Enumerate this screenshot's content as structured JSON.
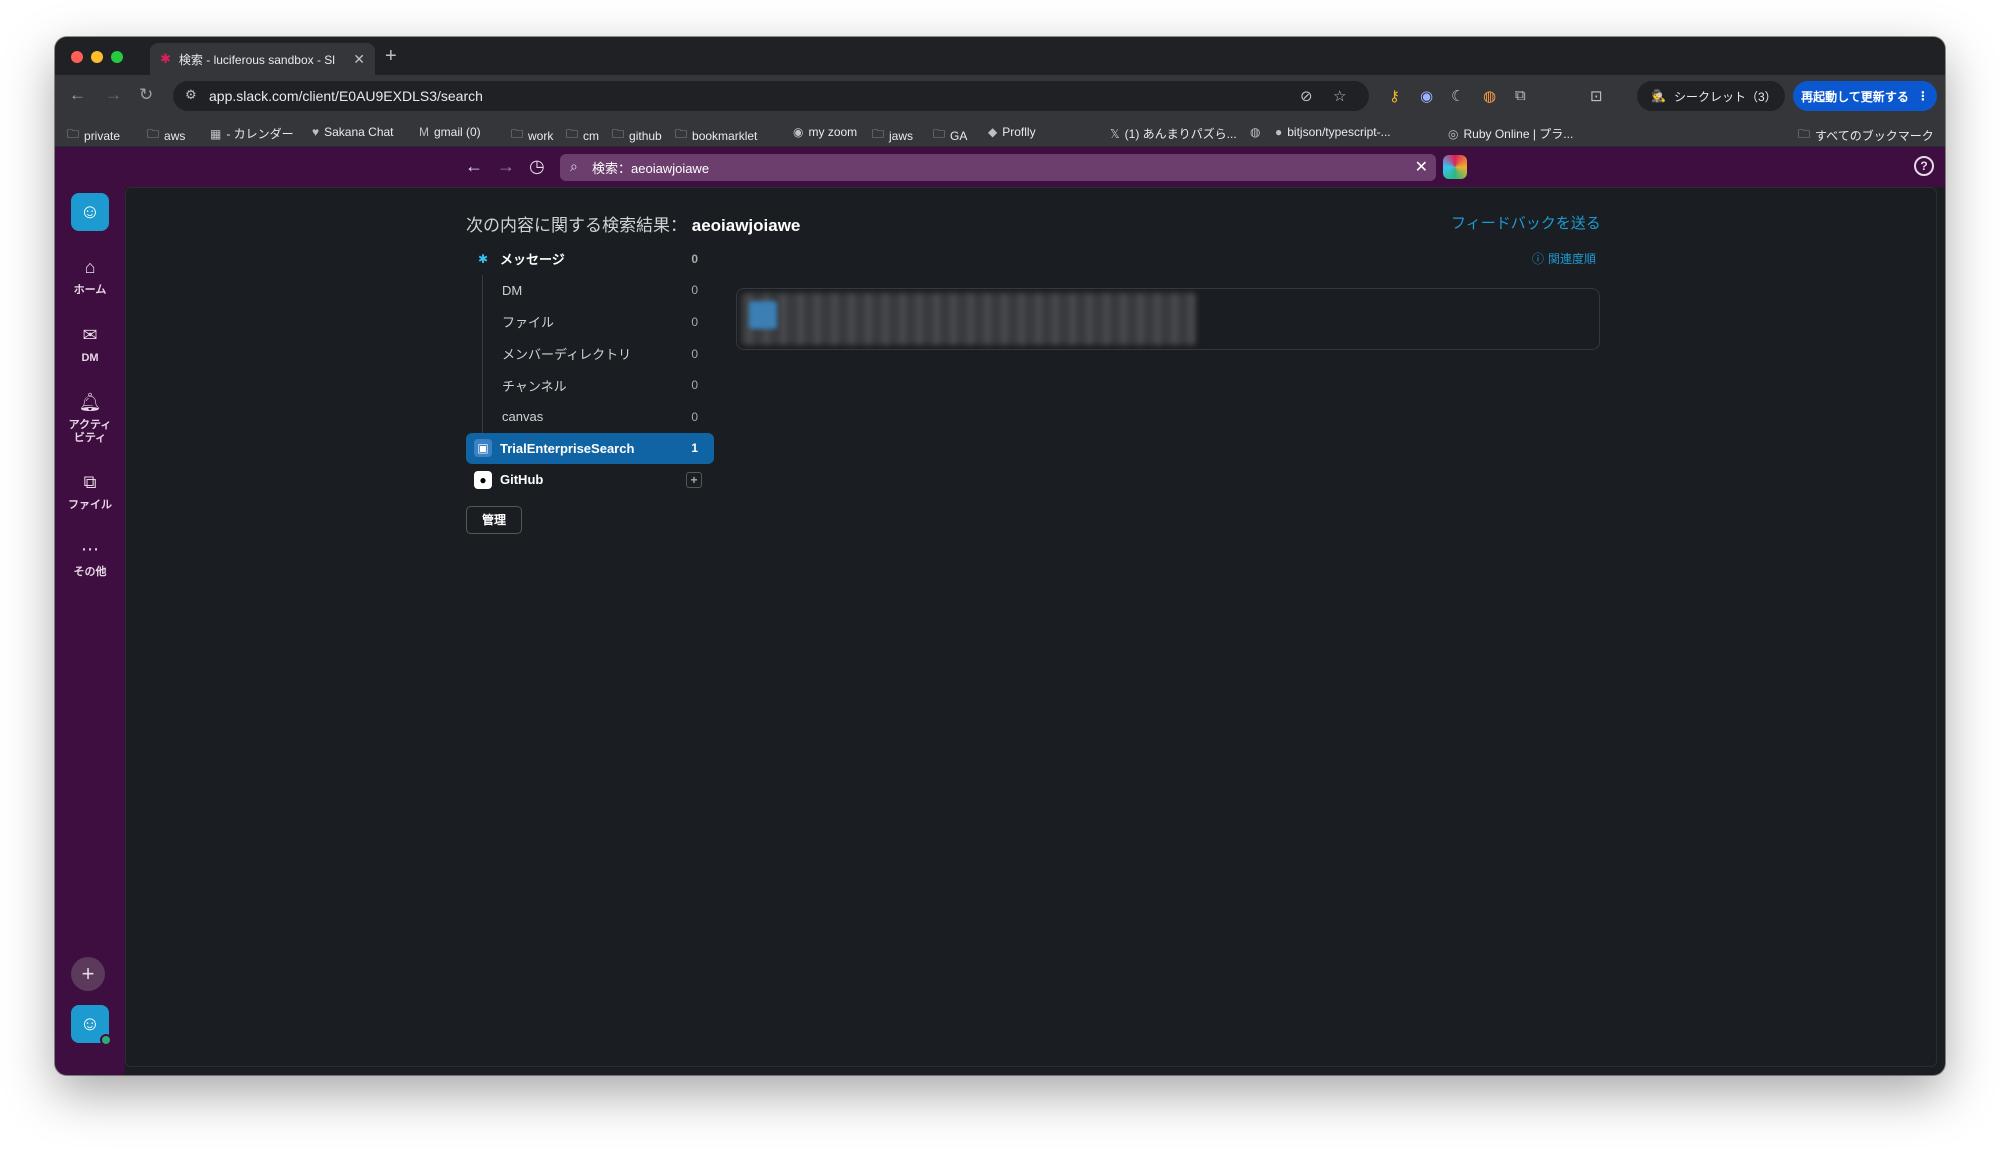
{
  "browser": {
    "tab_title": "検索 - luciferous sandbox - Sl",
    "url": "app.slack.com/client/E0AU9EXDLS3/search",
    "incognito_label": "シークレット（3）",
    "restart_label": "再起動して更新する",
    "bookmarks": [
      {
        "label": "private",
        "icon": "folder-icon"
      },
      {
        "label": "aws",
        "icon": "folder-icon"
      },
      {
        "label": "- カレンダー",
        "icon": "calendar-icon"
      },
      {
        "label": "Sakana Chat",
        "icon": "sakana-icon"
      },
      {
        "label": "gmail (0)",
        "icon": "gmail-icon"
      },
      {
        "label": "work",
        "icon": "folder-icon"
      },
      {
        "label": "cm",
        "icon": "folder-icon"
      },
      {
        "label": "github",
        "icon": "folder-icon"
      },
      {
        "label": "bookmarklet",
        "icon": "folder-icon"
      },
      {
        "label": "my zoom",
        "icon": "zoom-icon"
      },
      {
        "label": "jaws",
        "icon": "folder-icon"
      },
      {
        "label": "GA",
        "icon": "folder-icon"
      },
      {
        "label": "Proflly",
        "icon": "proflly-icon"
      },
      {
        "label": "(1) あんまりパズら...",
        "icon": "x-icon"
      },
      {
        "label": "",
        "icon": "globe-icon"
      },
      {
        "label": "bitjson/typescript-...",
        "icon": "github-icon"
      },
      {
        "label": "Ruby Online | プラ...",
        "icon": "ruby-icon"
      }
    ],
    "all_bookmarks": "すべてのブックマーク"
  },
  "slack": {
    "search_query_display": "検索：aeoiawjoiawe",
    "rail": [
      {
        "label": "ホーム",
        "icon": "home-icon"
      },
      {
        "label": "DM",
        "icon": "dm-icon"
      },
      {
        "label": "アクティビティ",
        "icon": "bell-icon"
      },
      {
        "label": "ファイル",
        "icon": "files-icon"
      },
      {
        "label": "その他",
        "icon": "more-icon"
      }
    ],
    "results_prefix": "次の内容に関する検索結果：",
    "query": "aeoiawjoiawe",
    "feedback": "フィードバックを送る",
    "sort": "関連度順",
    "filters": {
      "messages": {
        "label": "メッセージ",
        "count": "0"
      },
      "sub": [
        {
          "label": "DM",
          "count": "0"
        },
        {
          "label": "ファイル",
          "count": "0"
        },
        {
          "label": "メンバーディレクトリ",
          "count": "0"
        },
        {
          "label": "チャンネル",
          "count": "0"
        },
        {
          "label": "canvas",
          "count": "0"
        }
      ],
      "trial": {
        "label": "TrialEnterpriseSearch",
        "count": "1"
      },
      "github": {
        "label": "GitHub"
      },
      "manage": "管理"
    }
  },
  "colors": {
    "slack_aubergine": "#3f0e40",
    "active_blue": "#1164a3",
    "link_blue": "#1d9bd1"
  }
}
